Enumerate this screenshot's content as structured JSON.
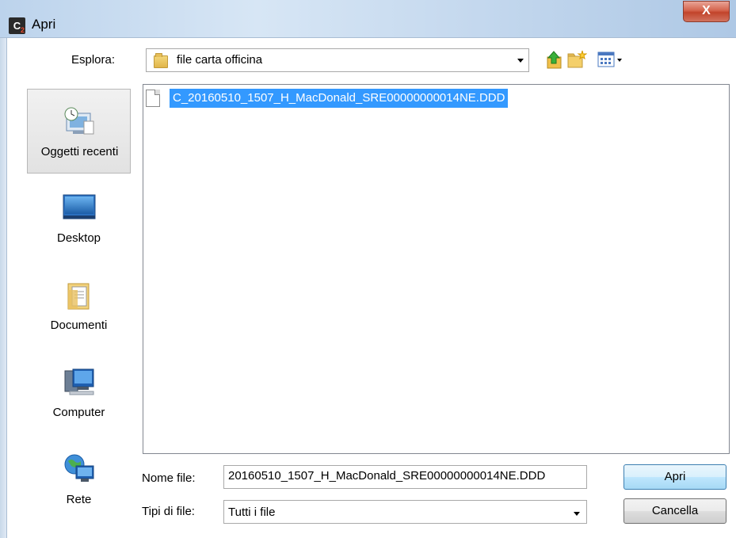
{
  "window": {
    "title": "Apri",
    "close_glyph": "X"
  },
  "app_icon": {
    "letter": "C",
    "sub": "2"
  },
  "look_in": {
    "label": "Esplora:",
    "value": "file carta officina"
  },
  "toolbar": {
    "icons": [
      "up-folder-icon",
      "new-folder-icon",
      "view-menu-icon"
    ]
  },
  "places": [
    {
      "label": "Oggetti recenti",
      "icon": "recent-items-icon",
      "selected": true
    },
    {
      "label": "Desktop",
      "icon": "desktop-icon",
      "selected": false
    },
    {
      "label": "Documenti",
      "icon": "documents-icon",
      "selected": false
    },
    {
      "label": "Computer",
      "icon": "computer-icon",
      "selected": false
    },
    {
      "label": "Rete",
      "icon": "network-icon",
      "selected": false
    }
  ],
  "files": [
    {
      "name": "C_20160510_1507_H_MacDonald_SRE00000000014NE.DDD",
      "selected": true
    }
  ],
  "filename": {
    "label": "Nome file:",
    "value": "20160510_1507_H_MacDonald_SRE00000000014NE.DDD"
  },
  "filetype": {
    "label": "Tipi di file:",
    "value": "Tutti i file"
  },
  "buttons": {
    "open": "Apri",
    "cancel": "Cancella"
  },
  "colors": {
    "selection": "#3399ff",
    "title_gradient": "#bcd3ec",
    "close": "#c2442b"
  }
}
